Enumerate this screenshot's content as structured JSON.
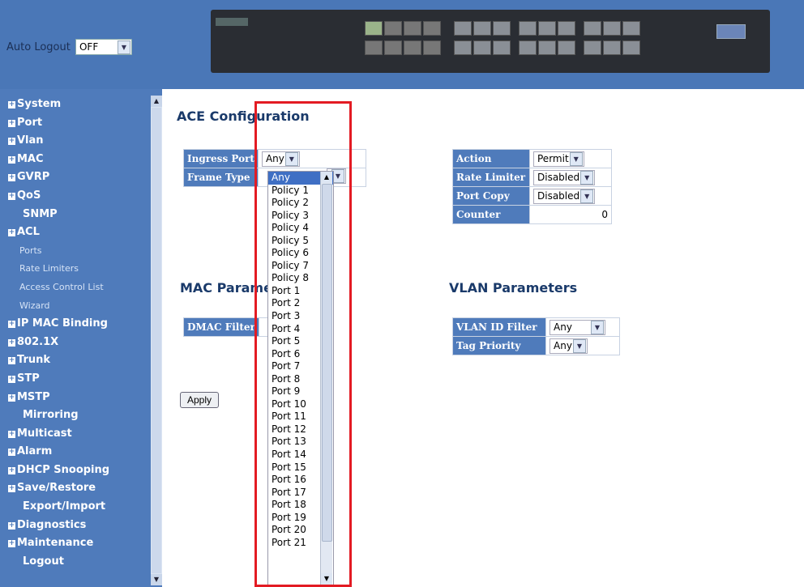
{
  "header": {
    "auto_logout_label": "Auto Logout",
    "auto_logout_value": "OFF"
  },
  "sidebar": {
    "items": [
      {
        "label": "System",
        "kind": "group"
      },
      {
        "label": "Port",
        "kind": "group"
      },
      {
        "label": "Vlan",
        "kind": "group"
      },
      {
        "label": "MAC",
        "kind": "group"
      },
      {
        "label": "GVRP",
        "kind": "group"
      },
      {
        "label": "QoS",
        "kind": "group"
      },
      {
        "label": "SNMP",
        "kind": "link"
      },
      {
        "label": "ACL",
        "kind": "group"
      },
      {
        "label": "Ports",
        "kind": "sub"
      },
      {
        "label": "Rate Limiters",
        "kind": "sub"
      },
      {
        "label": "Access Control List",
        "kind": "sub"
      },
      {
        "label": "Wizard",
        "kind": "sub"
      },
      {
        "label": "IP MAC Binding",
        "kind": "group"
      },
      {
        "label": "802.1X",
        "kind": "group"
      },
      {
        "label": "Trunk",
        "kind": "group"
      },
      {
        "label": "STP",
        "kind": "group"
      },
      {
        "label": "MSTP",
        "kind": "group"
      },
      {
        "label": "Mirroring",
        "kind": "link"
      },
      {
        "label": "Multicast",
        "kind": "group"
      },
      {
        "label": "Alarm",
        "kind": "group"
      },
      {
        "label": "DHCP Snooping",
        "kind": "group"
      },
      {
        "label": "Save/Restore",
        "kind": "group"
      },
      {
        "label": "Export/Import",
        "kind": "link"
      },
      {
        "label": "Diagnostics",
        "kind": "group"
      },
      {
        "label": "Maintenance",
        "kind": "group"
      },
      {
        "label": "Logout",
        "kind": "link"
      }
    ]
  },
  "main": {
    "title": "ACE Configuration",
    "ingress_port_label": "Ingress Port",
    "ingress_port_value": "Any",
    "frame_type_label": "Frame Type",
    "action_label": "Action",
    "action_value": "Permit",
    "rate_limiter_label": "Rate Limiter",
    "rate_limiter_value": "Disabled",
    "port_copy_label": "Port Copy",
    "port_copy_value": "Disabled",
    "counter_label": "Counter",
    "counter_value": "0",
    "mac_params_title": "MAC Paramet",
    "dmac_filter_label": "DMAC Filter",
    "vlan_params_title": "VLAN Parameters",
    "vlan_id_filter_label": "VLAN ID Filter",
    "vlan_id_filter_value": "Any",
    "tag_priority_label": "Tag Priority",
    "tag_priority_value": "Any",
    "apply_label": "Apply"
  },
  "dropdown_options": [
    "Any",
    "Policy 1",
    "Policy 2",
    "Policy 3",
    "Policy 4",
    "Policy 5",
    "Policy 6",
    "Policy 7",
    "Policy 8",
    "Port 1",
    "Port 2",
    "Port 3",
    "Port 4",
    "Port 5",
    "Port 6",
    "Port 7",
    "Port 8",
    "Port 9",
    "Port 10",
    "Port 11",
    "Port 12",
    "Port 13",
    "Port 14",
    "Port 15",
    "Port 16",
    "Port 17",
    "Port 18",
    "Port 19",
    "Port 20",
    "Port 21"
  ],
  "colors": {
    "nav_bg": "#4f7bbb",
    "header_bg": "#4a77b7",
    "highlight": "#e31b23",
    "selected_option": "#3f6fc4"
  }
}
